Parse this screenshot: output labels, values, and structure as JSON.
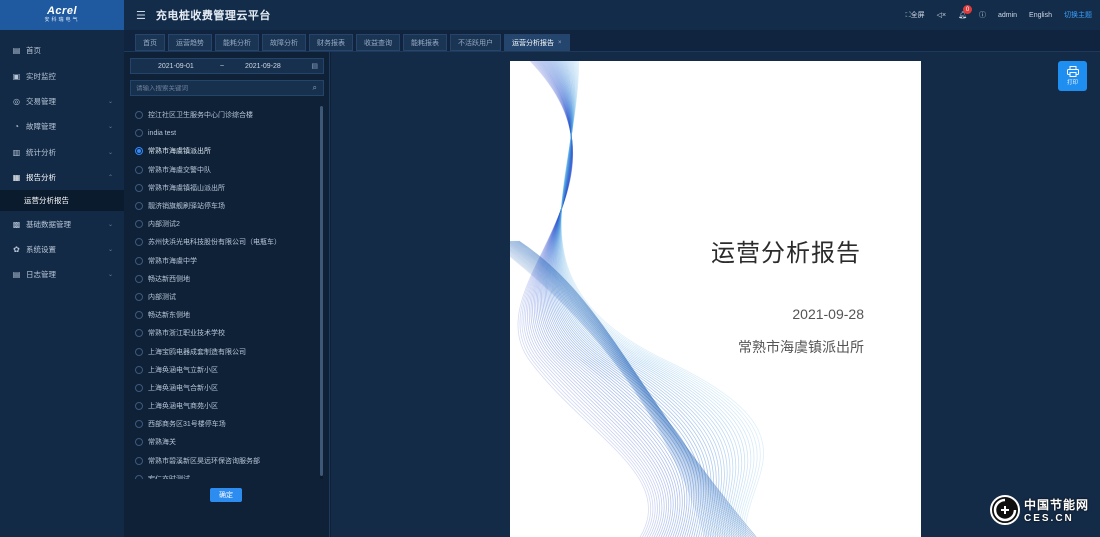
{
  "logo": {
    "brand": "Acrel",
    "sub": "安科瑞电气"
  },
  "header": {
    "title": "充电桩收费管理云平台",
    "fullscreen": "全屏",
    "notifications": "0",
    "user": "admin",
    "language": "English",
    "theme_link": "切换主题"
  },
  "sidebar": {
    "items": [
      {
        "label": "首页",
        "icon": "home-icon",
        "has_arrow": false
      },
      {
        "label": "实时监控",
        "icon": "monitor-icon",
        "has_arrow": false
      },
      {
        "label": "交易管理",
        "icon": "transaction-icon",
        "has_arrow": true
      },
      {
        "label": "故障管理",
        "icon": "fault-icon",
        "has_arrow": true
      },
      {
        "label": "统计分析",
        "icon": "statistics-icon",
        "has_arrow": true
      },
      {
        "label": "报告分析",
        "icon": "report-icon",
        "has_arrow": true,
        "open": true
      },
      {
        "label": "基础数据管理",
        "icon": "database-icon",
        "has_arrow": true
      },
      {
        "label": "系统设置",
        "icon": "settings-icon",
        "has_arrow": true
      },
      {
        "label": "日志管理",
        "icon": "log-icon",
        "has_arrow": true
      }
    ],
    "sub_item": "运营分析报告"
  },
  "tabs": [
    {
      "label": "首页",
      "active": false
    },
    {
      "label": "运营趋势",
      "active": false
    },
    {
      "label": "能耗分析",
      "active": false
    },
    {
      "label": "故障分析",
      "active": false
    },
    {
      "label": "财务报表",
      "active": false
    },
    {
      "label": "收益查询",
      "active": false
    },
    {
      "label": "能耗报表",
      "active": false
    },
    {
      "label": "不活跃用户",
      "active": false
    },
    {
      "label": "运营分析报告",
      "active": true
    }
  ],
  "filters": {
    "start_date": "2021-09-01",
    "separator": "~",
    "end_date": "2021-09-28",
    "search_placeholder": "请输入搜索关键词"
  },
  "stations": [
    {
      "name": "控江社区卫生服务中心门诊综合楼",
      "checked": false
    },
    {
      "name": "india test",
      "checked": false
    },
    {
      "name": "常熟市海虞镇派出所",
      "checked": true
    },
    {
      "name": "常熟市海虞交警中队",
      "checked": false
    },
    {
      "name": "常熟市海虞镇福山派出所",
      "checked": false
    },
    {
      "name": "靓济销旗舰刷驿站停车场",
      "checked": false
    },
    {
      "name": "内部测试2",
      "checked": false
    },
    {
      "name": "苏州快浜光电科技股份有限公司（电瓶车）",
      "checked": false
    },
    {
      "name": "常熟市海虞中学",
      "checked": false
    },
    {
      "name": "畅达新西侧地",
      "checked": false
    },
    {
      "name": "内部测试",
      "checked": false
    },
    {
      "name": "畅达新东侧地",
      "checked": false
    },
    {
      "name": "常熟市浙江职业技术学校",
      "checked": false
    },
    {
      "name": "上海宝鸥电器成套制造有限公司",
      "checked": false
    },
    {
      "name": "上海奂涵电气立新小区",
      "checked": false
    },
    {
      "name": "上海奂涵电气合新小区",
      "checked": false
    },
    {
      "name": "上海奂涵电气商苑小区",
      "checked": false
    },
    {
      "name": "西部商务区31号楼停车场",
      "checked": false
    },
    {
      "name": "常熟海关",
      "checked": false
    },
    {
      "name": "常熟市碧溪新区昊远环保咨询服务部",
      "checked": false
    },
    {
      "name": "宏仁亦时测试",
      "checked": false
    }
  ],
  "confirm_label": "确定",
  "report": {
    "title": "运营分析报告",
    "date": "2021-09-28",
    "organization": "常熟市海虞镇派出所"
  },
  "print_label": "打印",
  "watermark": {
    "cn": "中国节能网",
    "en": "CES.CN"
  },
  "colors": {
    "accent": "#2d8cf0",
    "sidebar_bg": "#122a46",
    "logo_bg": "#1f5aa0",
    "main_bg": "#142b47"
  }
}
